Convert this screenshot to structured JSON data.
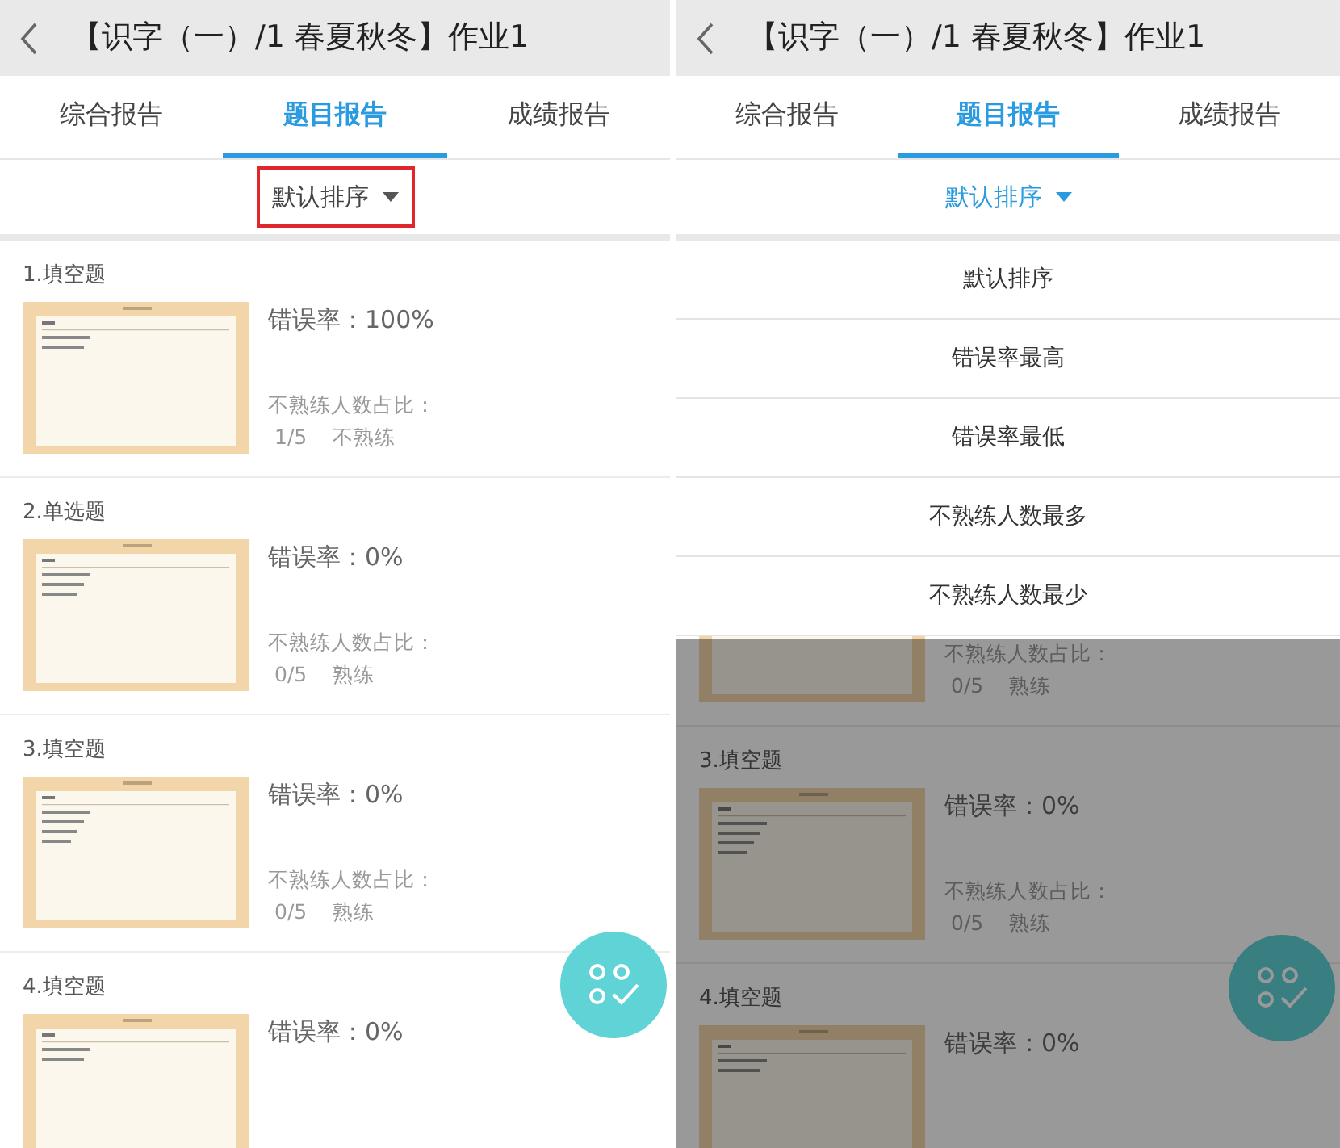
{
  "screens": [
    {
      "title": "【识字（一）/1 春夏秋冬】作业1",
      "tabs": [
        {
          "label": "综合报告",
          "selected": false
        },
        {
          "label": "题目报告",
          "selected": true
        },
        {
          "label": "成绩报告",
          "selected": false
        }
      ],
      "sort": {
        "label": "默认排序",
        "open": false,
        "highlighted": true
      },
      "questions": [
        {
          "title": "1.填空题",
          "error_rate": "错误率：100%",
          "stat_label": "不熟练人数占比：",
          "stat_value": "1/5",
          "status": "不熟练"
        },
        {
          "title": "2.单选题",
          "error_rate": "错误率：0%",
          "stat_label": "不熟练人数占比：",
          "stat_value": "0/5",
          "status": "熟练"
        },
        {
          "title": "3.填空题",
          "error_rate": "错误率：0%",
          "stat_label": "不熟练人数占比：",
          "stat_value": "0/5",
          "status": "熟练"
        },
        {
          "title": "4.填空题",
          "error_rate": "错误率：0%"
        }
      ]
    },
    {
      "title": "【识字（一）/1 春夏秋冬】作业1",
      "tabs": [
        {
          "label": "综合报告",
          "selected": false
        },
        {
          "label": "题目报告",
          "selected": true
        },
        {
          "label": "成绩报告",
          "selected": false
        }
      ],
      "sort": {
        "label": "默认排序",
        "open": true,
        "highlighted": false
      },
      "menu": [
        {
          "label": "默认排序"
        },
        {
          "label": "错误率最高"
        },
        {
          "label": "错误率最低"
        },
        {
          "label": "不熟练人数最多"
        },
        {
          "label": "不熟练人数最少"
        }
      ],
      "questions": [
        {
          "stat_label": "不熟练人数占比：",
          "stat_value": "0/5",
          "status": "熟练"
        },
        {
          "title": "3.填空题",
          "error_rate": "错误率：0%",
          "stat_label": "不熟练人数占比：",
          "stat_value": "0/5",
          "status": "熟练"
        },
        {
          "title": "4.填空题",
          "error_rate": "错误率：0%"
        }
      ]
    }
  ]
}
